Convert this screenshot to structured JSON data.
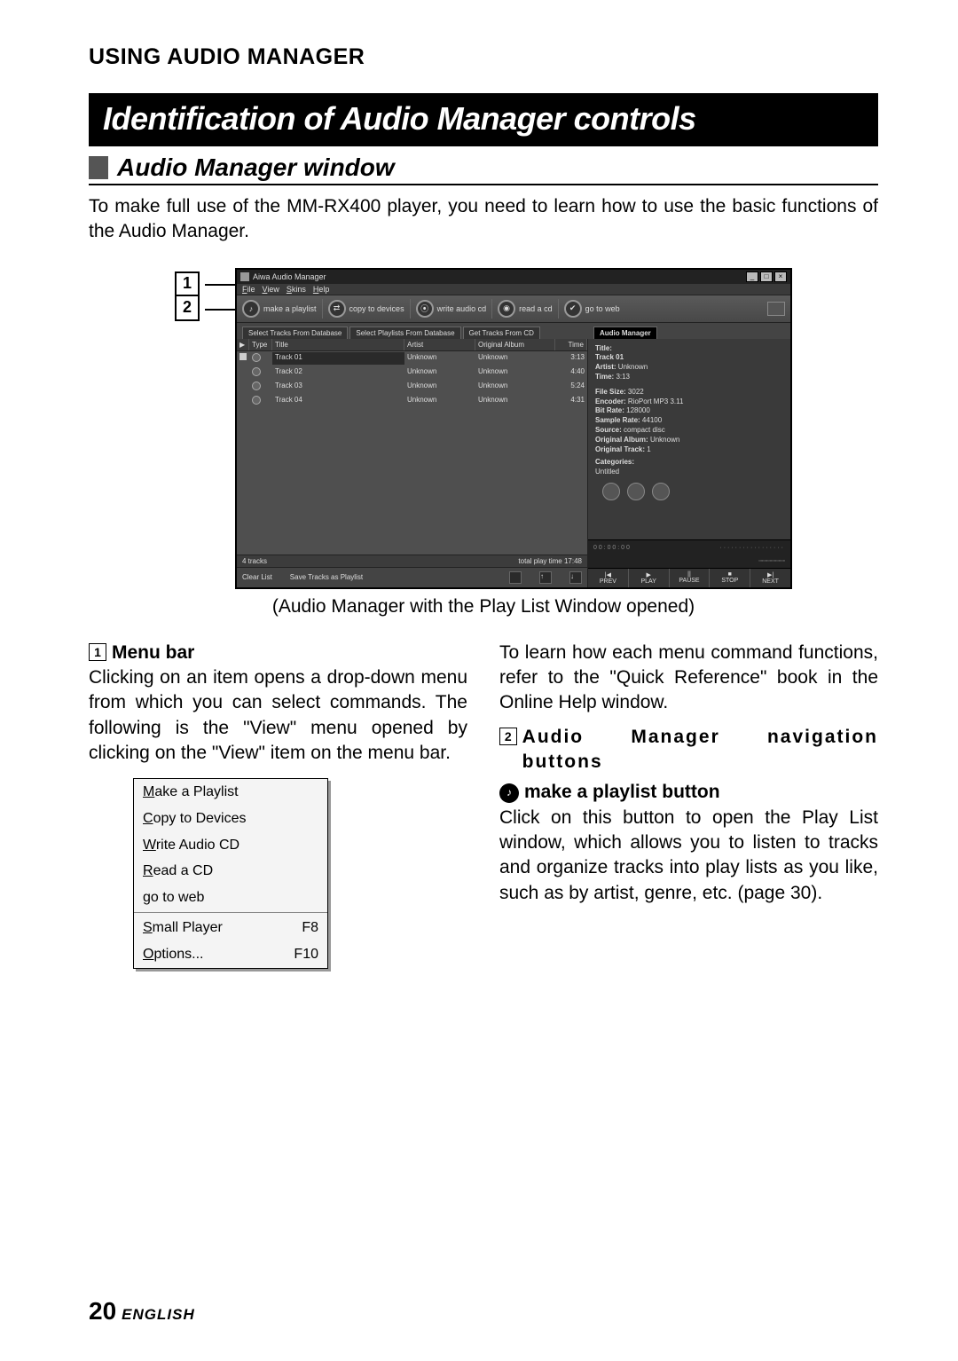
{
  "header": {
    "running": "USING AUDIO MANAGER"
  },
  "title_bar": "Identification of Audio Manager controls",
  "subtitle": "Audio Manager window",
  "intro": "To make full use of the MM-RX400 player, you need to learn how to use the basic functions of the Audio Manager.",
  "side_markers": [
    "1",
    "2"
  ],
  "app": {
    "title": "Aiwa Audio Manager",
    "menu": [
      "File",
      "View",
      "Skins",
      "Help"
    ],
    "toolbar": [
      {
        "label": "make a playlist"
      },
      {
        "label": "copy to devices"
      },
      {
        "label": "write audio cd"
      },
      {
        "label": "read a cd"
      },
      {
        "label": "go to web"
      }
    ],
    "tabs": [
      "Select Tracks From Database",
      "Select Playlists From Database",
      "Get Tracks From CD"
    ],
    "right_tab": "Audio Manager",
    "columns": {
      "play": "▶",
      "type": "Type",
      "title": "Title",
      "artist": "Artist",
      "album": "Original Album",
      "time": "Time"
    },
    "tracks": [
      {
        "title": "Track 01",
        "artist": "Unknown",
        "album": "Unknown",
        "time": "3:13",
        "sel": true,
        "stop": true
      },
      {
        "title": "Track 02",
        "artist": "Unknown",
        "album": "Unknown",
        "time": "4:40"
      },
      {
        "title": "Track 03",
        "artist": "Unknown",
        "album": "Unknown",
        "time": "5:24"
      },
      {
        "title": "Track 04",
        "artist": "Unknown",
        "album": "Unknown",
        "time": "4:31"
      }
    ],
    "footer_left": "4 tracks",
    "footer_right": "total play time 17:48",
    "actions": [
      "Clear List",
      "Save Tracks as Playlist"
    ],
    "info": {
      "title_label": "Title:",
      "title_value": "Track 01",
      "artist_label": "Artist:",
      "artist_value": "Unknown",
      "time_label": "Time:",
      "time_value": "3:13",
      "filesize_label": "File Size:",
      "filesize_value": "3022",
      "encoder_label": "Encoder:",
      "encoder_value": "RioPort MP3 3.11",
      "bitrate_label": "Bit Rate:",
      "bitrate_value": "128000",
      "samplerate_label": "Sample Rate:",
      "samplerate_value": "44100",
      "source_label": "Source:",
      "source_value": "compact disc",
      "origalbum_label": "Original Album:",
      "origalbum_value": "Unknown",
      "origtrack_label": "Original Track:",
      "origtrack_value": "1",
      "categories_label": "Categories:",
      "categories_value": "Untitled"
    },
    "player_display": "0 0 : 0 0 : 0 0",
    "player_ctrls": [
      {
        "sym": "|◀",
        "lbl": "PREV"
      },
      {
        "sym": "▶",
        "lbl": "PLAY"
      },
      {
        "sym": "||",
        "lbl": "PAUSE"
      },
      {
        "sym": "■",
        "lbl": "STOP"
      },
      {
        "sym": "▶|",
        "lbl": "NEXT"
      }
    ]
  },
  "caption": "(Audio Manager with the Play List Window opened)",
  "left_col": {
    "num": "1",
    "head": "Menu bar",
    "body": "Clicking on an item opens a drop-down menu from which you can select commands. The following is the \"View\" menu opened by clicking on the \"View\" item on the menu bar.",
    "menu_items": [
      {
        "label": "Make a Playlist"
      },
      {
        "label": "Copy to Devices"
      },
      {
        "label": "Write Audio CD"
      },
      {
        "label": "Read a CD"
      },
      {
        "label": "go to web"
      }
    ],
    "menu_items2": [
      {
        "label": "Small Player",
        "key": "F8"
      },
      {
        "label": "Options...",
        "key": "F10"
      }
    ]
  },
  "right_col": {
    "top": "To learn how each menu command functions, refer to the \"Quick Reference\" book in the Online Help window.",
    "num": "2",
    "head": "Audio Manager navigation buttons",
    "sub_head": "make a playlist button",
    "body": "Click on this button to open the Play List window, which allows you to listen to tracks and organize tracks into play lists as you like, such as by artist, genre, etc. (page 30)."
  },
  "footer": {
    "page": "20",
    "lang": "ENGLISH"
  }
}
